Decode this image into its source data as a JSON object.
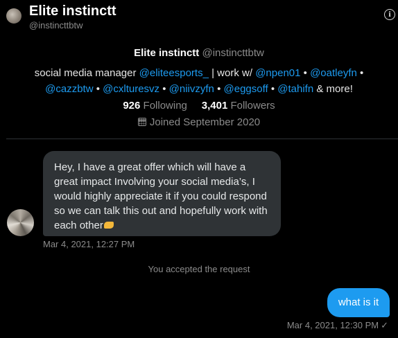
{
  "header": {
    "name": "Elite instinctt",
    "handle": "@instincttbtw",
    "info_icon": "i"
  },
  "profile": {
    "name": "Elite instinctt",
    "handle": "@instincttbtw",
    "bio_prefix": "social media manager ",
    "bio_mentions": [
      "@eliteesports_",
      "@npen01",
      "@oatleyfn",
      "@cazzbtw",
      "@cxlturesvz",
      "@niivzyfn",
      "@eggsoff",
      "@tahifn"
    ],
    "bio_sep_work": " | work w/ ",
    "bio_bullet": " • ",
    "bio_suffix": " & more!",
    "following_count": "926",
    "following_label": "Following",
    "followers_count": "3,401",
    "followers_label": "Followers",
    "joined": "Joined September 2020"
  },
  "messages": [
    {
      "direction": "incoming",
      "lines": [
        "Hey, I have a great offer which will have a",
        "great impact Involving your social media’s, I",
        "would highly appreciate it if you could respond",
        "so we can talk this out and hopefully work with",
        "each other"
      ],
      "emoji": "handshake",
      "timestamp": "Mar 4, 2021, 12:27 PM"
    },
    {
      "direction": "outgoing",
      "text": "what is it",
      "timestamp": "Mar 4, 2021, 12:30 PM",
      "status": "✓"
    }
  ],
  "system": {
    "accepted": "You accepted the request"
  },
  "colors": {
    "background": "#000000",
    "accent": "#1d9bf0",
    "bubble_in": "#2f3336",
    "muted": "#8b8b8b"
  }
}
